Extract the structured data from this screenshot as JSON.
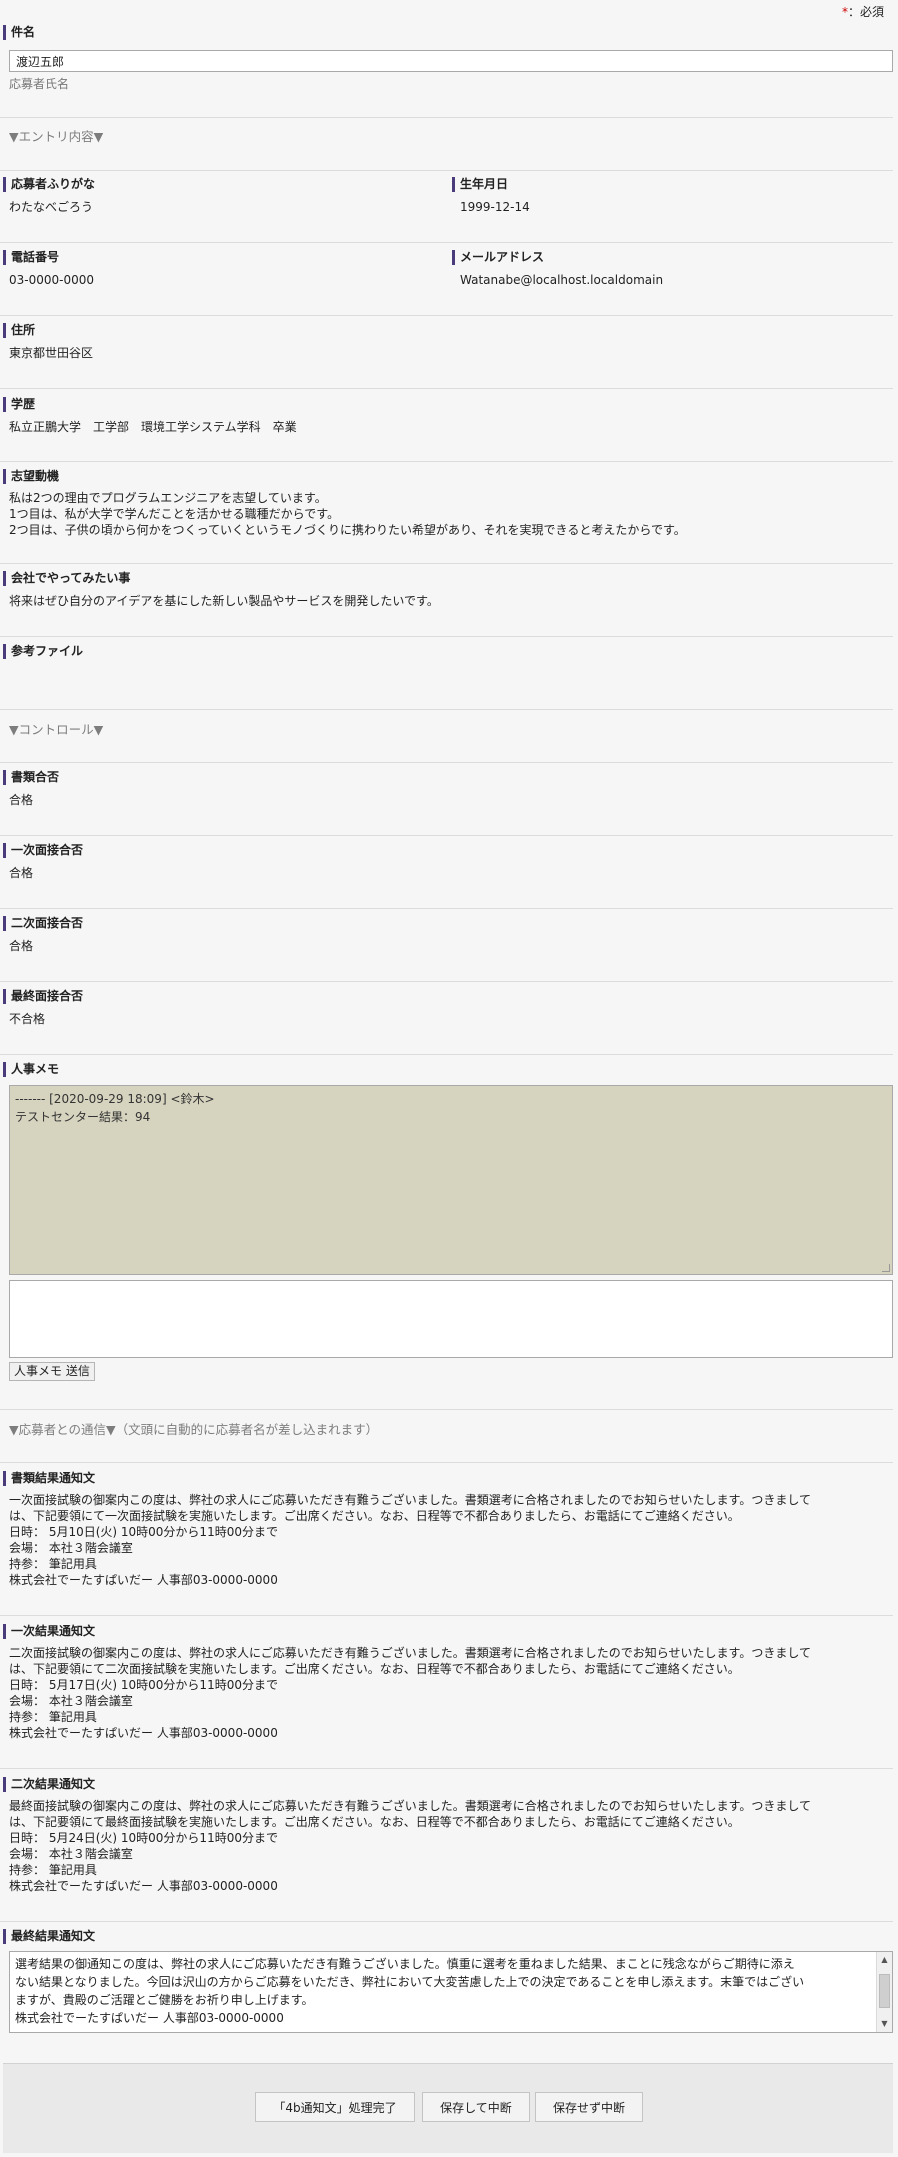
{
  "required_note": {
    "star": "*",
    "text": "：必須"
  },
  "subject": {
    "label": "件名",
    "value": "渡辺五郎",
    "hint": "応募者氏名"
  },
  "entry_section": {
    "heading": "▼エントリ内容▼"
  },
  "kana": {
    "label": "応募者ふりがな",
    "value": "わたなべごろう"
  },
  "birth": {
    "label": "生年月日",
    "value": "1999-12-14"
  },
  "phone": {
    "label": "電話番号",
    "value": "03-0000-0000"
  },
  "email": {
    "label": "メールアドレス",
    "value": "Watanabe@localhost.localdomain"
  },
  "address": {
    "label": "住所",
    "value": "東京都世田谷区"
  },
  "education": {
    "label": "学歴",
    "value": "私立正鵬大学　工学部　環境工学システム学科　卒業"
  },
  "motivation": {
    "label": "志望動機",
    "lines": [
      "私は2つの理由でプログラムエンジニアを志望しています。",
      "1つ目は、私が大学で学んだことを活かせる職種だからです。",
      "2つ目は、子供の頃から何かをつくっていくというモノづくりに携わりたい希望があり、それを実現できると考えたからです。"
    ]
  },
  "wish": {
    "label": "会社でやってみたい事",
    "value": "将来はぜひ自分のアイデアを基にした新しい製品やサービスを開発したいです。"
  },
  "files": {
    "label": "参考ファイル"
  },
  "control_section": {
    "heading": "▼コントロール▼"
  },
  "doc_pass": {
    "label": "書類合否",
    "value": "合格"
  },
  "first_pass": {
    "label": "一次面接合否",
    "value": "合格"
  },
  "second_pass": {
    "label": "二次面接合否",
    "value": "合格"
  },
  "final_pass": {
    "label": "最終面接合否",
    "value": "不合格"
  },
  "hr_memo": {
    "label": "人事メモ",
    "log_lines": [
      "------- [2020-09-29 18:09] <鈴木>",
      "テストセンター結果：94"
    ],
    "input_value": "",
    "send_button": "人事メモ 送信"
  },
  "comm_section": {
    "heading": "▼応募者との通信▼（文頭に自動的に応募者名が差し込まれます）"
  },
  "doc_notice": {
    "label": "書類結果通知文",
    "lines": [
      "一次面接試験の御案内この度は、弊社の求人にご応募いただき有難うございました。書類選考に合格されましたのでお知らせいたします。つきまして",
      "は、下記要領にて一次面接試験を実施いたします。ご出席ください。なお、日程等で不都合ありましたら、お電話にてご連絡ください。",
      "日時： 5月10日(火) 10時00分から11時00分まで",
      "会場： 本社３階会議室",
      "持参： 筆記用具",
      "株式会社でーたすぱいだー 人事部03-0000-0000"
    ]
  },
  "first_notice": {
    "label": "一次結果通知文",
    "lines": [
      "二次面接試験の御案内この度は、弊社の求人にご応募いただき有難うございました。書類選考に合格されましたのでお知らせいたします。つきまして",
      "は、下記要領にて二次面接試験を実施いたします。ご出席ください。なお、日程等で不都合ありましたら、お電話にてご連絡ください。",
      "日時： 5月17日(火) 10時00分から11時00分まで",
      "会場： 本社３階会議室",
      "持参： 筆記用具",
      "株式会社でーたすぱいだー 人事部03-0000-0000"
    ]
  },
  "second_notice": {
    "label": "二次結果通知文",
    "lines": [
      "最終面接試験の御案内この度は、弊社の求人にご応募いただき有難うございました。書類選考に合格されましたのでお知らせいたします。つきまして",
      "は、下記要領にて最終面接試験を実施いたします。ご出席ください。なお、日程等で不都合ありましたら、お電話にてご連絡ください。",
      "日時： 5月24日(火) 10時00分から11時00分まで",
      "会場： 本社３階会議室",
      "持参： 筆記用具",
      "株式会社でーたすぱいだー 人事部03-0000-0000"
    ]
  },
  "final_notice": {
    "label": "最終結果通知文",
    "lines": [
      "選考結果の御通知この度は、弊社の求人にご応募いただき有難うございました。慎重に選考を重ねました結果、まことに残念ながらご期待に添え",
      "ない結果となりました。今回は沢山の方からご応募をいただき、弊社において大変苦慮した上での決定であることを申し添えます。末筆ではござい",
      "ますが、貴殿のご活躍とご健勝をお祈り申し上げます。",
      "株式会社でーたすぱいだー 人事部03-0000-0000"
    ]
  },
  "footer": {
    "complete_button": "「4b通知文」処理完了",
    "save_suspend_button": "保存して中断",
    "nosave_suspend_button": "保存せず中断"
  }
}
